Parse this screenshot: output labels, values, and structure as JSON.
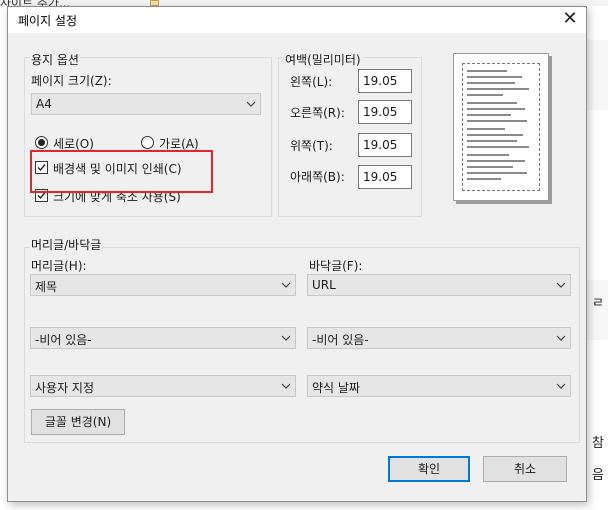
{
  "background": {
    "top_text": "사이트 추가...",
    "right_chars": [
      "ㄹ",
      "참",
      "음"
    ]
  },
  "dialog": {
    "title": "페이지 설정",
    "close_glyph": "✕"
  },
  "paper_options": {
    "group_label": "용지 옵션",
    "size_label": "페이지 크기(Z):",
    "size_value": "A4",
    "portrait_label": "세로(O)",
    "landscape_label": "가로(A)",
    "orientation_selected": "portrait",
    "print_background_label": "배경색 및 이미지 인쇄(C)",
    "print_background_checked": true,
    "shrink_to_fit_label": "크기에 맞게 축소 사용(S)",
    "shrink_to_fit_checked": true
  },
  "margins": {
    "group_label": "여백(밀리미터)",
    "left_label": "왼쪽(L):",
    "left_value": "19.05",
    "right_label": "오른쪽(R):",
    "right_value": "19.05",
    "top_label": "위쪽(T):",
    "top_value": "19.05",
    "bottom_label": "아래쪽(B):",
    "bottom_value": "19.05"
  },
  "header_footer": {
    "group_label": "머리글/바닥글",
    "header_label": "머리글(H):",
    "footer_label": "바닥글(F):",
    "header_1": "제목",
    "footer_1": "URL",
    "header_2": "-비어 있음-",
    "footer_2": "-비어 있음-",
    "header_3": "사용자 지정",
    "footer_3": "약식 날짜",
    "font_button": "글꼴 변경(N)"
  },
  "buttons": {
    "ok": "확인",
    "cancel": "취소"
  },
  "colors": {
    "dialog_bg": "#f0f0f0",
    "highlight_border": "#e3262b",
    "default_button_border": "#0078d7"
  }
}
